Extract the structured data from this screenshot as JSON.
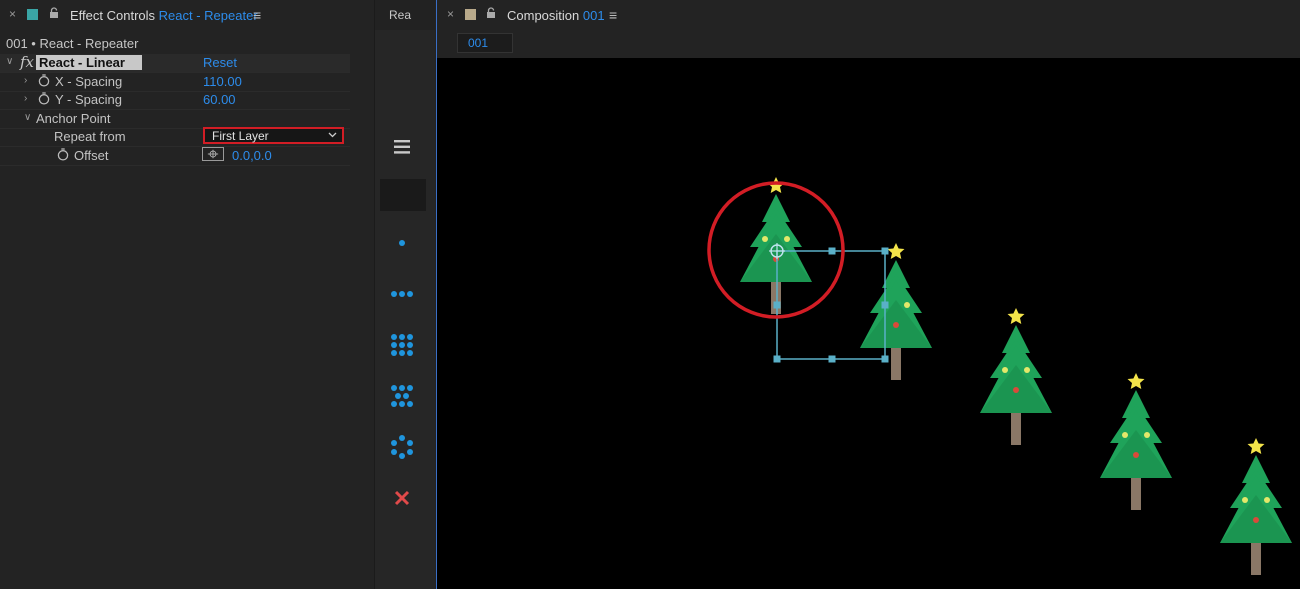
{
  "effect_controls": {
    "close_glyph": "×",
    "title": "Effect Controls",
    "layer_name": "React - Repeater",
    "menu_glyph": "≡",
    "swatch_color": "#3aa6a6",
    "layer_path": "001 • React - Repeater",
    "effect": {
      "fx_glyph": "fx",
      "name": "React - Linear",
      "reset_label": "Reset"
    },
    "properties": {
      "x_spacing": {
        "label": "X - Spacing",
        "value": "110.00"
      },
      "y_spacing": {
        "label": "Y - Spacing",
        "value": "60.00"
      },
      "anchor_point": {
        "label": "Anchor Point"
      },
      "repeat_from": {
        "label": "Repeat from",
        "value": "First Layer"
      },
      "offset": {
        "label": "Offset",
        "value": "0.0,0.0"
      }
    }
  },
  "middle_panel": {
    "tab_label": "Rea",
    "buttons": [
      "menu-icon",
      "single-dot-icon",
      "three-dots-icon",
      "grid-icon",
      "staggered-grid-icon",
      "radial-dots-icon",
      "close-x-icon"
    ]
  },
  "composition": {
    "close_glyph": "×",
    "title": "Composition",
    "comp_name": "001",
    "menu_glyph": "≡",
    "swatch_color": "#b8a98a",
    "tab_label": "001"
  },
  "colors": {
    "accent_blue": "#2d8ceb",
    "highlight_red": "#d21d25",
    "tree_green": "#1fa35a",
    "tree_green_dark": "#178a4a",
    "trunk": "#8a7766",
    "star": "#f4e44a",
    "ornament_yellow": "#e3e86a",
    "ornament_red": "#d94a3a",
    "selection": "#5ab0c8"
  }
}
